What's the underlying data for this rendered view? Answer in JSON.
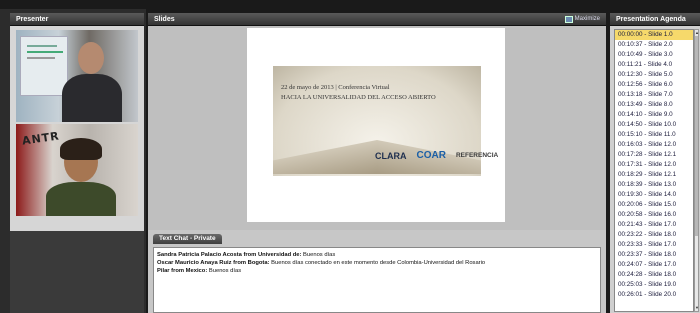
{
  "presenter": {
    "header": "Presenter",
    "video_1_wall_text": "",
    "video_2_wall_text": "ANTR"
  },
  "slides": {
    "header": "Slides",
    "maximize_label": "Maximize",
    "slide_line_1": "22 de mayo de 2013 | Conferencia Virtual",
    "slide_line_2": "HACIA LA UNIVERSALIDAD DEL ACCESO ABIERTO",
    "logos": [
      "CLARA",
      "COAR",
      "REFERENCIA"
    ]
  },
  "chat": {
    "tab_label": "Text Chat - Private",
    "messages": [
      {
        "sender": "Sandra Patricia Palacio Acosta from Universidad de:",
        "text": " Buenos días"
      },
      {
        "sender": "Oscar Mauricio Anaya Ruiz from Bogota:",
        "text": " Buenos días conectado en este momento desde Colombia-Universidad del Rosario"
      },
      {
        "sender": "Pilar from Mexico:",
        "text": " Buenos días"
      }
    ]
  },
  "agenda": {
    "header": "Presentation Agenda",
    "items": [
      "00:00:00 - Slide 1.0",
      "00:10:37 - Slide 2.0",
      "00:10:49 - Slide 3.0",
      "00:11:21 - Slide 4.0",
      "00:12:30 - Slide 5.0",
      "00:12:56 - Slide 6.0",
      "00:13:18 - Slide 7.0",
      "00:13:49 - Slide 8.0",
      "00:14:10 - Slide 9.0",
      "00:14:50 - Slide 10.0",
      "00:15:10 - Slide 11.0",
      "00:16:03 - Slide 12.0",
      "00:17:28 - Slide 12.1",
      "00:17:31 - Slide 12.0",
      "00:18:29 - Slide 12.1",
      "00:18:39 - Slide 13.0",
      "00:19:30 - Slide 14.0",
      "00:20:06 - Slide 15.0",
      "00:20:58 - Slide 16.0",
      "00:21:43 - Slide 17.0",
      "00:23:22 - Slide 18.0",
      "00:23:33 - Slide 17.0",
      "00:23:37 - Slide 18.0",
      "00:24:07 - Slide 17.0",
      "00:24:28 - Slide 18.0",
      "00:25:03 - Slide 19.0",
      "00:26:01 - Slide 20.0"
    ],
    "selected_index": 0
  },
  "colors": {
    "selected_agenda": "#f6d96b",
    "header_bg": "#444444",
    "slides_bg": "#bfbfbf"
  }
}
